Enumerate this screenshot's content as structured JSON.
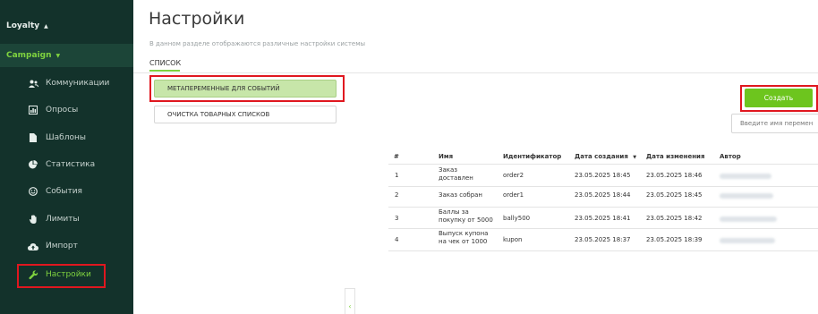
{
  "sidebar": {
    "loyalty_label": "Loyalty",
    "campaign_label": "Campaign",
    "items": [
      {
        "label": "Коммуникации",
        "icon": "users-icon"
      },
      {
        "label": "Опросы",
        "icon": "poll-icon"
      },
      {
        "label": "Шаблоны",
        "icon": "file-icon"
      },
      {
        "label": "Статистика",
        "icon": "pie-chart-icon"
      },
      {
        "label": "События",
        "icon": "smile-icon"
      },
      {
        "label": "Лимиты",
        "icon": "hand-icon"
      },
      {
        "label": "Импорт",
        "icon": "cloud-upload-icon"
      },
      {
        "label": "Настройки",
        "icon": "wrench-icon",
        "active": true
      }
    ]
  },
  "page": {
    "title": "Настройки",
    "subtitle": "В данном разделе отображаются различные настройки системы",
    "tab": "СПИСОК"
  },
  "menu": {
    "item1": "МЕТАПЕРЕМЕННЫЕ ДЛЯ СОБЫТИЙ",
    "item2": "ОЧИСТКА ТОВАРНЫХ СПИСКОВ"
  },
  "toolbar": {
    "create_label": "Создать",
    "search_placeholder": "Введите имя перемен"
  },
  "table": {
    "headers": {
      "num": "#",
      "name": "Имя",
      "id": "Идентификатор",
      "created": "Дата создания",
      "updated": "Дата изменения",
      "author": "Автор"
    },
    "rows": [
      {
        "num": "1",
        "name": "Заказ доставлен",
        "id": "order2",
        "created": "23.05.2025 18:45",
        "updated": "23.05.2025 18:46"
      },
      {
        "num": "2",
        "name": "Заказ собран",
        "id": "order1",
        "created": "23.05.2025 18:44",
        "updated": "23.05.2025 18:45"
      },
      {
        "num": "3",
        "name": "Баллы за покупку от 5000",
        "id": "bally500",
        "created": "23.05.2025 18:41",
        "updated": "23.05.2025 18:42"
      },
      {
        "num": "4",
        "name": "Выпуск купона на чек от 1000",
        "id": "kupon",
        "created": "23.05.2025 18:37",
        "updated": "23.05.2025 18:39"
      }
    ]
  },
  "colors": {
    "sidebar_bg": "#13322b",
    "accent_green": "#7fd33f",
    "button_green": "#6dc51e",
    "highlight_red": "#e0171f"
  }
}
